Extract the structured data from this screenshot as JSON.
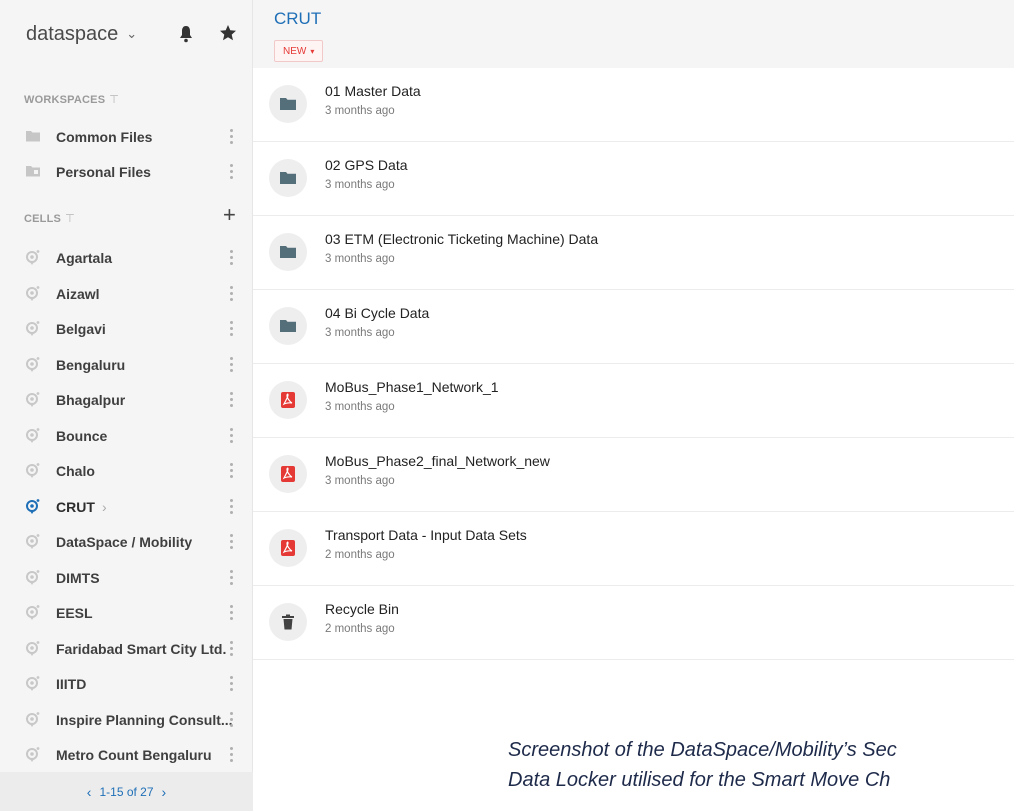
{
  "sidebar": {
    "brand": "dataspace",
    "workspaces_header": "WORKSPACES",
    "cells_header": "CELLS",
    "workspaces": [
      {
        "label": "Common Files",
        "icon": "folder-icon"
      },
      {
        "label": "Personal Files",
        "icon": "personal-folder-icon"
      }
    ],
    "cells": [
      {
        "label": "Agartala"
      },
      {
        "label": "Aizawl"
      },
      {
        "label": "Belgavi"
      },
      {
        "label": "Bengaluru"
      },
      {
        "label": "Bhagalpur"
      },
      {
        "label": "Bounce"
      },
      {
        "label": "Chalo"
      },
      {
        "label": "CRUT",
        "active": true
      },
      {
        "label": "DataSpace / Mobility"
      },
      {
        "label": "DIMTS"
      },
      {
        "label": "EESL"
      },
      {
        "label": "Faridabad Smart City Ltd."
      },
      {
        "label": "IIITD"
      },
      {
        "label": "Inspire Planning Consult..."
      },
      {
        "label": "Metro Count Bengaluru"
      }
    ],
    "pager": "1-15 of 27"
  },
  "main": {
    "title": "CRUT",
    "new_label": "NEW",
    "items": [
      {
        "name": "01 Master Data",
        "time": "3 months ago",
        "type": "folder"
      },
      {
        "name": "02 GPS Data",
        "time": "3 months ago",
        "type": "folder"
      },
      {
        "name": "03 ETM (Electronic Ticketing Machine) Data",
        "time": "3 months ago",
        "type": "folder"
      },
      {
        "name": "04 Bi Cycle Data",
        "time": "3 months ago",
        "type": "folder"
      },
      {
        "name": "MoBus_Phase1_Network_1",
        "time": "3 months ago",
        "type": "pdf"
      },
      {
        "name": "MoBus_Phase2_final_Network_new",
        "time": "3 months ago",
        "type": "pdf"
      },
      {
        "name": "Transport Data - Input Data Sets",
        "time": "2 months ago",
        "type": "pdf"
      },
      {
        "name": "Recycle Bin",
        "time": "2 months ago",
        "type": "trash"
      }
    ]
  },
  "caption": {
    "line1": "Screenshot of the DataSpace/Mobility’s Sec",
    "line2": "Data Locker utilised for the Smart Move Ch"
  },
  "colors": {
    "accent": "#1f6fb7",
    "new_red": "#e53935",
    "pdf_red": "#e53935",
    "icon_dark": "#546e7a",
    "active_cell_icon": "#1f6fb7"
  }
}
